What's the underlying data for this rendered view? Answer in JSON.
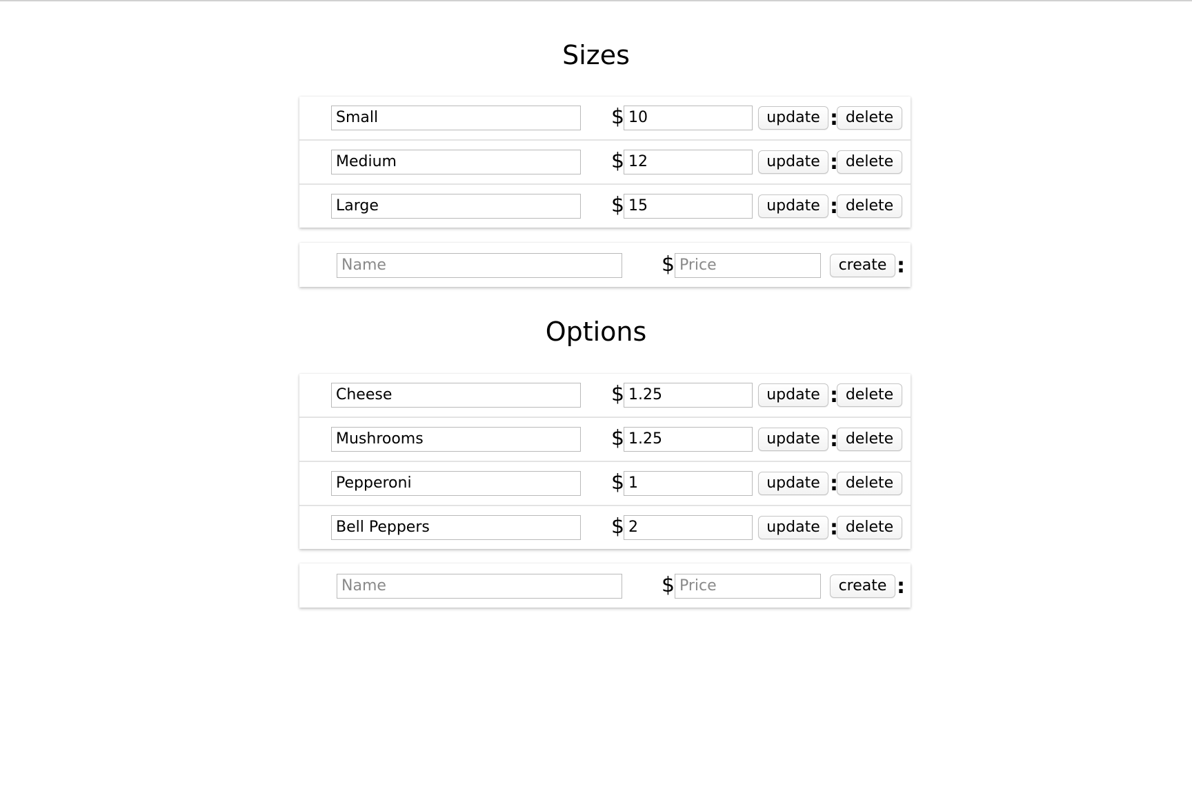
{
  "sizes": {
    "title": "Sizes",
    "items": [
      {
        "name": "Small",
        "price": "10"
      },
      {
        "name": "Medium",
        "price": "12"
      },
      {
        "name": "Large",
        "price": "15"
      }
    ],
    "create": {
      "name_placeholder": "Name",
      "price_placeholder": "Price"
    }
  },
  "options": {
    "title": "Options",
    "items": [
      {
        "name": "Cheese",
        "price": "1.25"
      },
      {
        "name": "Mushrooms",
        "price": "1.25"
      },
      {
        "name": "Pepperoni",
        "price": "1"
      },
      {
        "name": "Bell Peppers",
        "price": "2"
      }
    ],
    "create": {
      "name_placeholder": "Name",
      "price_placeholder": "Price"
    }
  },
  "labels": {
    "currency": "$",
    "separator": ":",
    "update": "update",
    "delete": "delete",
    "create": "create"
  }
}
